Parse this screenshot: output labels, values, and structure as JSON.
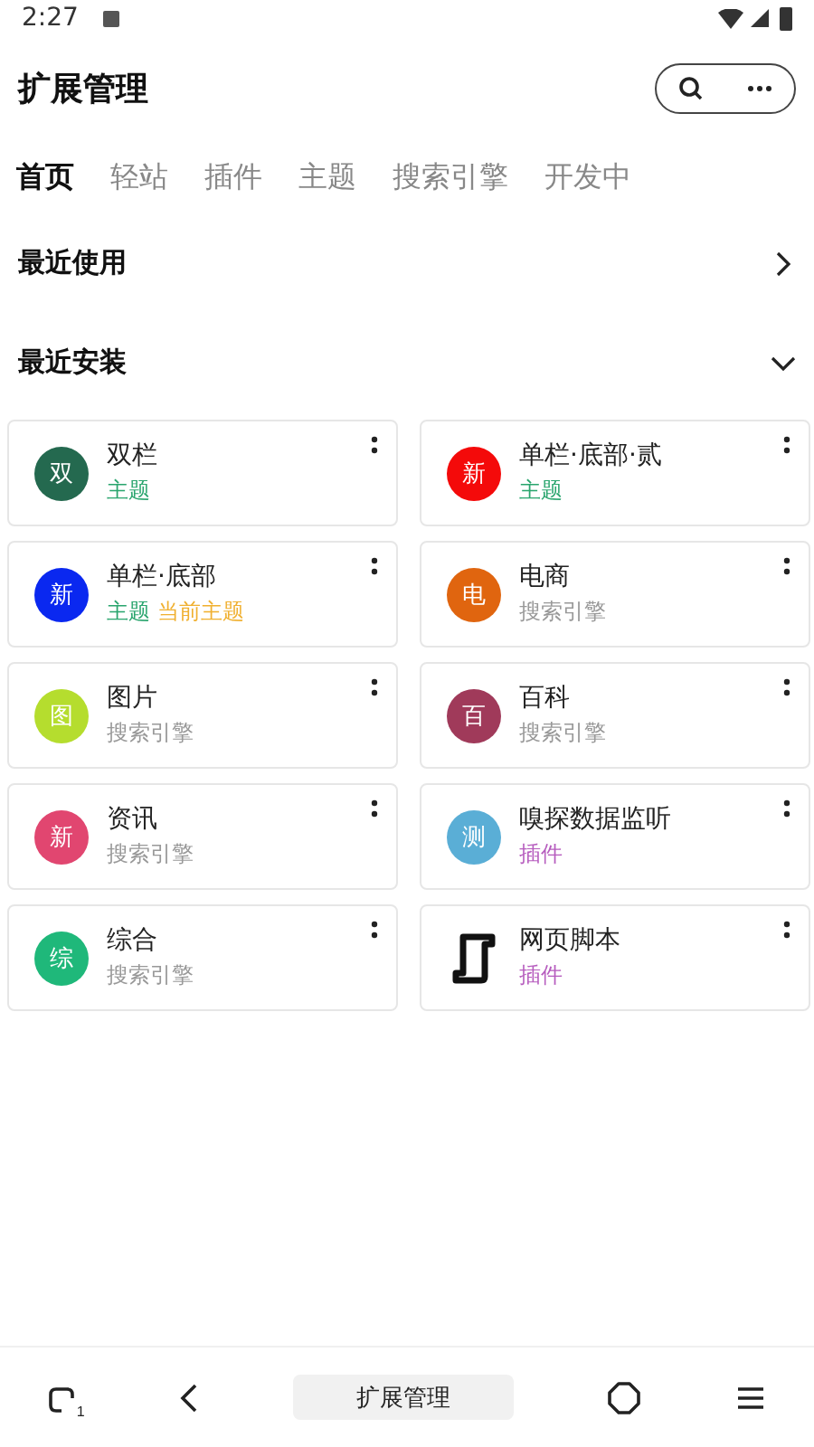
{
  "status_bar": {
    "time": "2:27"
  },
  "header": {
    "title": "扩展管理"
  },
  "tabs": [
    {
      "label": "首页",
      "selected": true
    },
    {
      "label": "轻站",
      "selected": false
    },
    {
      "label": "插件",
      "selected": false
    },
    {
      "label": "主题",
      "selected": false
    },
    {
      "label": "搜索引擎",
      "selected": false
    },
    {
      "label": "开发中",
      "selected": false
    }
  ],
  "sections": [
    {
      "title": "最近使用",
      "expanded": false
    },
    {
      "title": "最近安装",
      "expanded": true
    }
  ],
  "extensions": [
    {
      "name": "双栏",
      "icon": {
        "kind": "letter",
        "char": "双",
        "color": "#24694f"
      },
      "tags": [
        {
          "kind": "theme",
          "text": "主题"
        }
      ]
    },
    {
      "name": "单栏·底部·贰",
      "icon": {
        "kind": "letter",
        "char": "新",
        "color": "#f40a0a"
      },
      "tags": [
        {
          "kind": "theme",
          "text": "主题"
        }
      ]
    },
    {
      "name": "单栏·底部",
      "icon": {
        "kind": "letter",
        "char": "新",
        "color": "#0a28f0"
      },
      "tags": [
        {
          "kind": "theme",
          "text": "主题"
        },
        {
          "kind": "current",
          "text": "当前主题"
        }
      ]
    },
    {
      "name": "电商",
      "icon": {
        "kind": "letter",
        "char": "电",
        "color": "#e0650f"
      },
      "tags": [
        {
          "kind": "search",
          "text": "搜索引擎"
        }
      ]
    },
    {
      "name": "图片",
      "icon": {
        "kind": "letter",
        "char": "图",
        "color": "#b5dd2e"
      },
      "tags": [
        {
          "kind": "search",
          "text": "搜索引擎"
        }
      ]
    },
    {
      "name": "百科",
      "icon": {
        "kind": "letter",
        "char": "百",
        "color": "#a03a5a"
      },
      "tags": [
        {
          "kind": "search",
          "text": "搜索引擎"
        }
      ]
    },
    {
      "name": "资讯",
      "icon": {
        "kind": "letter",
        "char": "新",
        "color": "#e14670"
      },
      "tags": [
        {
          "kind": "search",
          "text": "搜索引擎"
        }
      ]
    },
    {
      "name": "嗅探数据监听",
      "icon": {
        "kind": "letter",
        "char": "测",
        "color": "#5aaed6"
      },
      "tags": [
        {
          "kind": "plugin",
          "text": "插件"
        }
      ]
    },
    {
      "name": "综合",
      "icon": {
        "kind": "letter",
        "char": "综",
        "color": "#1fb87a"
      },
      "tags": [
        {
          "kind": "search",
          "text": "搜索引擎"
        }
      ]
    },
    {
      "name": "网页脚本",
      "icon": {
        "kind": "script"
      },
      "tags": [
        {
          "kind": "plugin",
          "text": "插件"
        }
      ]
    }
  ],
  "bottom_bar": {
    "tab_count": "1",
    "title": "扩展管理"
  }
}
